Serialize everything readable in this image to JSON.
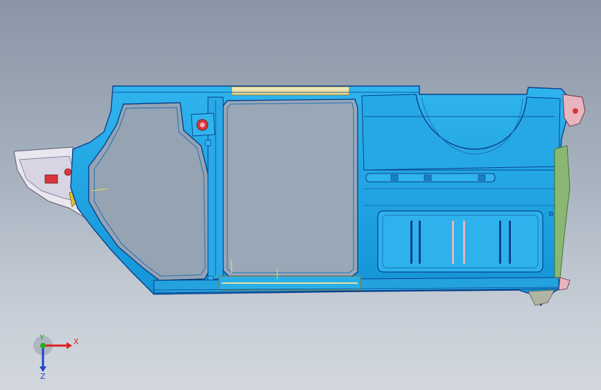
{
  "viewport": {
    "background_top": "#8a96a6",
    "background_bottom": "#d3d8de"
  },
  "model": {
    "primary_color": "#1aa3e0",
    "edge_color": "#0a3f8a",
    "accent_red": "#d8343a",
    "accent_yellow": "#e8e3a0",
    "accent_pink": "#e8b4c0",
    "accent_green": "#8ab874"
  },
  "triad": {
    "x_label": "X",
    "y_label": "Y",
    "z_label": "Z",
    "x_color": "#e02020",
    "y_color": "#20b020",
    "z_color": "#2040d0"
  }
}
